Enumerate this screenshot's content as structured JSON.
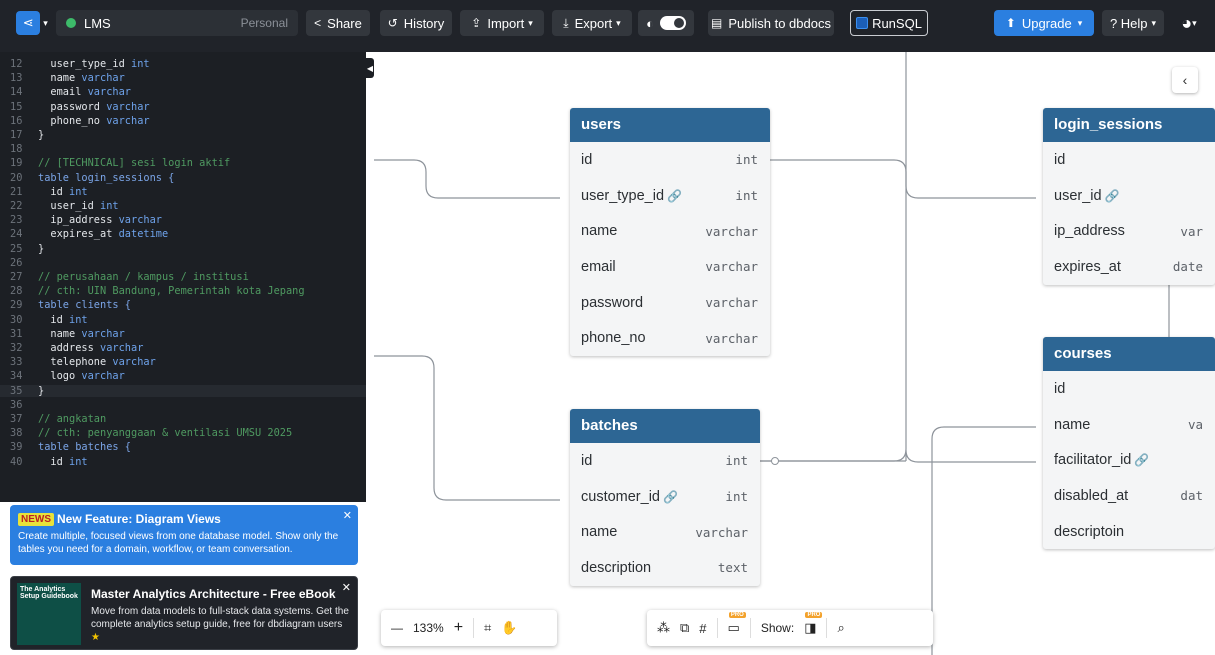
{
  "topbar": {
    "project_name": "LMS",
    "project_scope": "Personal",
    "share": "Share",
    "history": "History",
    "import": "Import",
    "export": "Export",
    "publish": "Publish to dbdocs",
    "runsql": "RunSQL",
    "upgrade": "Upgrade",
    "help": "? Help"
  },
  "editor": {
    "lines": [
      {
        "n": "12",
        "code": "  user_type_id ",
        "type": "int"
      },
      {
        "n": "13",
        "code": "  name ",
        "type": "varchar"
      },
      {
        "n": "14",
        "code": "  email ",
        "type": "varchar"
      },
      {
        "n": "15",
        "code": "  password ",
        "type": "varchar"
      },
      {
        "n": "16",
        "code": "  phone_no ",
        "type": "varchar"
      },
      {
        "n": "17",
        "code": "}",
        "type": ""
      },
      {
        "n": "18",
        "code": "",
        "type": ""
      },
      {
        "n": "19",
        "code": "",
        "comment": "// [TECHNICAL] sesi login aktif"
      },
      {
        "n": "20",
        "code": "table login_sessions {",
        "kw": "table"
      },
      {
        "n": "21",
        "code": "  id ",
        "type": "int"
      },
      {
        "n": "22",
        "code": "  user_id ",
        "type": "int"
      },
      {
        "n": "23",
        "code": "  ip_address ",
        "type": "varchar"
      },
      {
        "n": "24",
        "code": "  expires_at ",
        "type": "datetime"
      },
      {
        "n": "25",
        "code": "}",
        "type": ""
      },
      {
        "n": "26",
        "code": "",
        "type": ""
      },
      {
        "n": "27",
        "code": "",
        "comment": "// perusahaan / kampus / institusi"
      },
      {
        "n": "28",
        "code": "",
        "comment": "// cth: UIN Bandung, Pemerintah kota Jepang"
      },
      {
        "n": "29",
        "code": "table clients {",
        "kw": "table"
      },
      {
        "n": "30",
        "code": "  id ",
        "type": "int"
      },
      {
        "n": "31",
        "code": "  name ",
        "type": "varchar"
      },
      {
        "n": "32",
        "code": "  address ",
        "type": "varchar"
      },
      {
        "n": "33",
        "code": "  telephone ",
        "type": "varchar"
      },
      {
        "n": "34",
        "code": "  logo ",
        "type": "varchar"
      },
      {
        "n": "35",
        "code": "}",
        "type": ""
      },
      {
        "n": "36",
        "code": "",
        "type": ""
      },
      {
        "n": "37",
        "code": "",
        "comment": "// angkatan"
      },
      {
        "n": "38",
        "code": "",
        "comment": "// cth: penyanggaan & ventilasi UMSU 2025"
      },
      {
        "n": "39",
        "code": "table batches {",
        "kw": "table"
      },
      {
        "n": "40",
        "code": "  id ",
        "type": "int"
      }
    ]
  },
  "news": {
    "badge": "NEWS",
    "title": "New Feature: Diagram Views",
    "body": "Create multiple, focused views from one database model. Show only the tables you need for a domain, workflow, or team conversation."
  },
  "ebook": {
    "cover": "The Analytics Setup Guidebook",
    "title": "Master Analytics Architecture - Free eBook",
    "desc": "Move from data models to full-stack data systems. Get the complete analytics setup guide, free for dbdiagram users"
  },
  "tables": {
    "users": {
      "title": "users",
      "rows": [
        [
          "id",
          "int"
        ],
        [
          "user_type_id",
          "int"
        ],
        [
          "name",
          "varchar"
        ],
        [
          "email",
          "varchar"
        ],
        [
          "password",
          "varchar"
        ],
        [
          "phone_no",
          "varchar"
        ]
      ]
    },
    "batches": {
      "title": "batches",
      "rows": [
        [
          "id",
          "int"
        ],
        [
          "customer_id",
          "int"
        ],
        [
          "name",
          "varchar"
        ],
        [
          "description",
          "text"
        ]
      ]
    },
    "login_sessions": {
      "title": "login_sessions",
      "rows": [
        [
          "id",
          ""
        ],
        [
          "user_id",
          ""
        ],
        [
          "ip_address",
          "var"
        ],
        [
          "expires_at",
          "date"
        ]
      ]
    },
    "courses": {
      "title": "courses",
      "rows": [
        [
          "id",
          ""
        ],
        [
          "name",
          "va"
        ],
        [
          "facilitator_id",
          ""
        ],
        [
          "disabled_at",
          "dat"
        ],
        [
          "descriptoin",
          ""
        ]
      ]
    }
  },
  "toolbar": {
    "zoom_minus": "—",
    "zoom": "133%",
    "zoom_plus": "+",
    "show": "Show:",
    "pro": "PRO"
  }
}
